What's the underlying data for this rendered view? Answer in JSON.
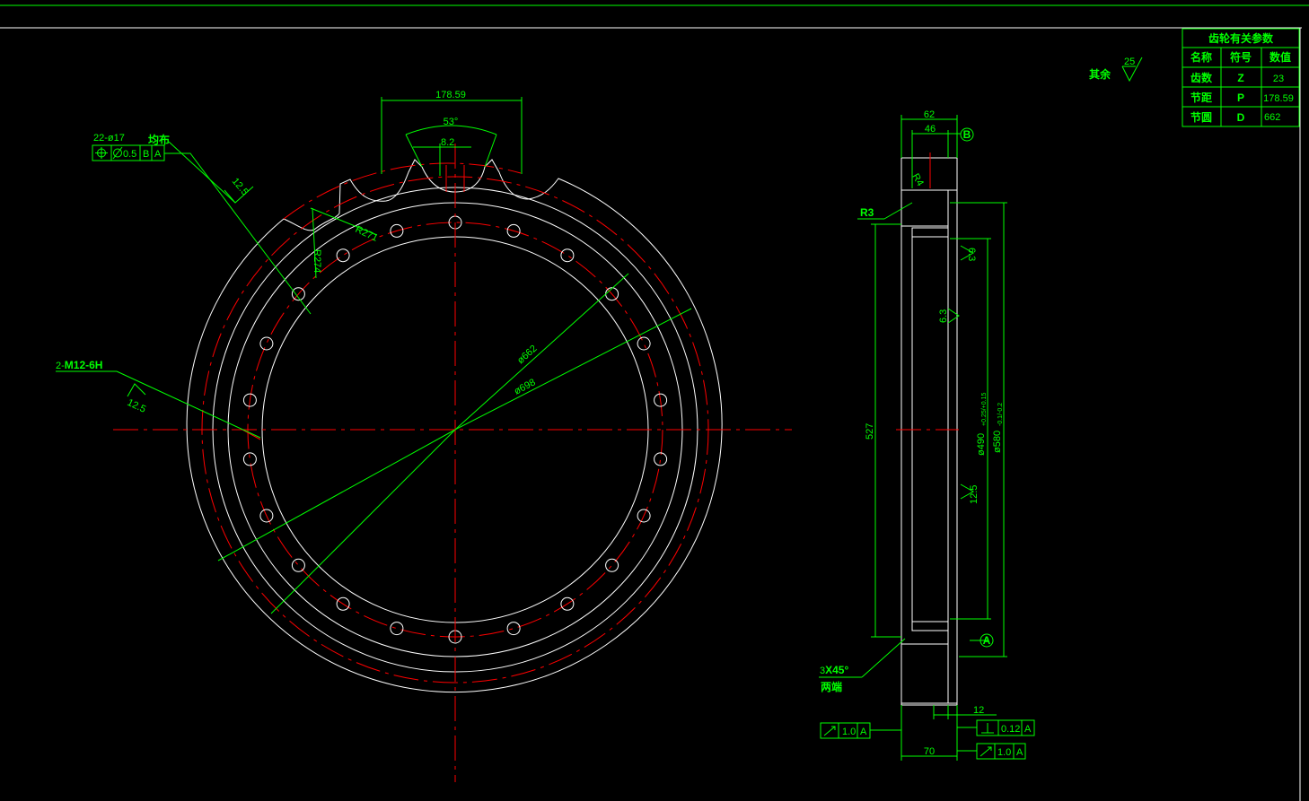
{
  "table": {
    "title": "齿轮有关参数",
    "headers": [
      "名称",
      "符号",
      "数值"
    ],
    "rows": [
      {
        "name": "齿数",
        "symbol": "Z",
        "value": "23"
      },
      {
        "name": "节距",
        "symbol": "P",
        "value": "178.59"
      },
      {
        "name": "节圆",
        "symbol": "D",
        "value": "662"
      }
    ]
  },
  "roughness_note": {
    "text": "其余",
    "value": "25"
  },
  "front_view": {
    "chord_dim": "178.59",
    "angle_dim": "53°",
    "tooth_dim": "8.2",
    "hole_callout": "22-ø17",
    "hole_callout_2": "均布",
    "position_tol": [
      "0.5",
      "B",
      "A"
    ],
    "roughness_top": "12.5",
    "r271": "R271",
    "r274": "R274",
    "d662": "ø662",
    "d698": "ø698",
    "thread_callout": "2-M12-6H",
    "thread_callout_prefix": "2-",
    "thread_callout_main": "M12-6H",
    "thread_roughness": "12.5"
  },
  "side_view": {
    "dim_62": "62",
    "dim_46": "46",
    "datum_b": "B",
    "datum_a": "A",
    "r3": "R3",
    "r4": "R4",
    "dim_527": "527",
    "d490": "ø490",
    "d580": "ø580",
    "d490_tol": "+0.25/+0.15",
    "d580_tol": "-0.1/-0.2",
    "rough_63a": "6.3",
    "rough_63b": "6.3",
    "rough_125": "12.5",
    "chamfer": "3X45°",
    "chamfer_prefix": "3",
    "chamfer_main": "X45°",
    "chamfer_note": "两端",
    "dim_12": "12",
    "dim_70": "70",
    "tol_runout_left": [
      "1.0",
      "A"
    ],
    "tol_perp": [
      "0.12",
      "A"
    ],
    "tol_runout_right": [
      "1.0",
      "A"
    ]
  }
}
